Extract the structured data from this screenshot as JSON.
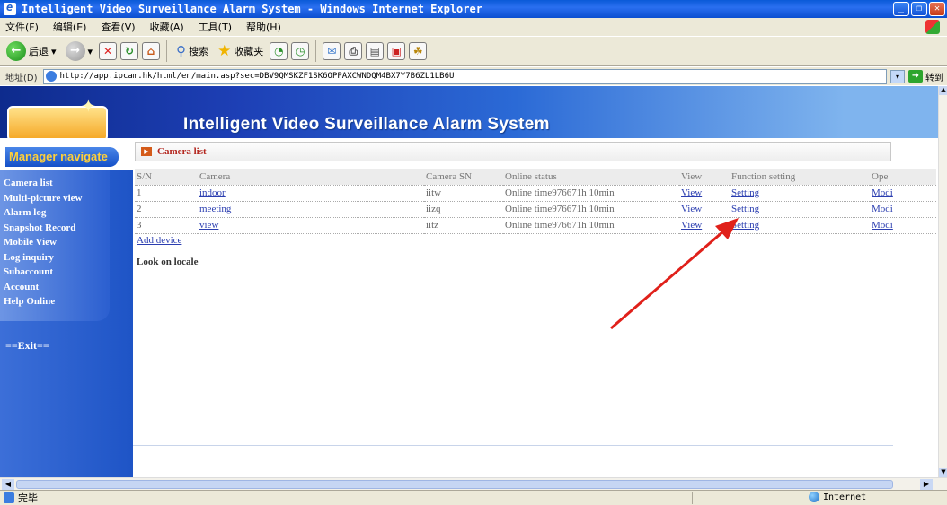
{
  "window": {
    "title": "Intelligent Video Surveillance Alarm System - Windows Internet Explorer"
  },
  "menu": [
    "文件(F)",
    "编辑(E)",
    "查看(V)",
    "收藏(A)",
    "工具(T)",
    "帮助(H)"
  ],
  "toolbar": {
    "back_label": "后退",
    "search_label": "搜索",
    "favorites_label": "收藏夹"
  },
  "address": {
    "label": "地址(D)",
    "url": "http://app.ipcam.hk/html/en/main.asp?sec=DBV9QMSKZF1SK6OPPAXCWNDQM4BX7Y7B6ZL1LB6U",
    "go_label": "转到"
  },
  "banner": {
    "title": "Intelligent Video Surveillance Alarm System"
  },
  "sidebar": {
    "title": "Manager navigate",
    "items": [
      "Camera list",
      "Multi-picture view",
      "Alarm log",
      "Snapshot Record",
      "Mobile View",
      "Log inquiry",
      "Subaccount",
      "Account",
      "Help Online"
    ],
    "exit": "==Exit=="
  },
  "panel": {
    "title": "Camera list"
  },
  "table": {
    "headers": [
      "S/N",
      "Camera",
      "Camera SN",
      "Online status",
      "View",
      "Function setting",
      "Ope"
    ],
    "rows": [
      {
        "sn": "1",
        "camera": "indoor",
        "camera_sn": "iitw",
        "status": "Online time976671h 10min",
        "view": "View",
        "setting": "Setting",
        "op": "Modi"
      },
      {
        "sn": "2",
        "camera": "meeting",
        "camera_sn": "iizq",
        "status": "Online time976671h 10min",
        "view": "View",
        "setting": "Setting",
        "op": "Modi"
      },
      {
        "sn": "3",
        "camera": "view",
        "camera_sn": "iitz",
        "status": "Online time976671h 10min",
        "view": "View",
        "setting": "Setting",
        "op": "Modi"
      }
    ],
    "add_link": "Add device",
    "look": "Look on locale"
  },
  "status": {
    "text": "完毕",
    "zone": "Internet"
  },
  "colors": {
    "annotation_arrow": "#e0201a",
    "link": "#2b3eb0",
    "banner": "#1d3fb5"
  }
}
